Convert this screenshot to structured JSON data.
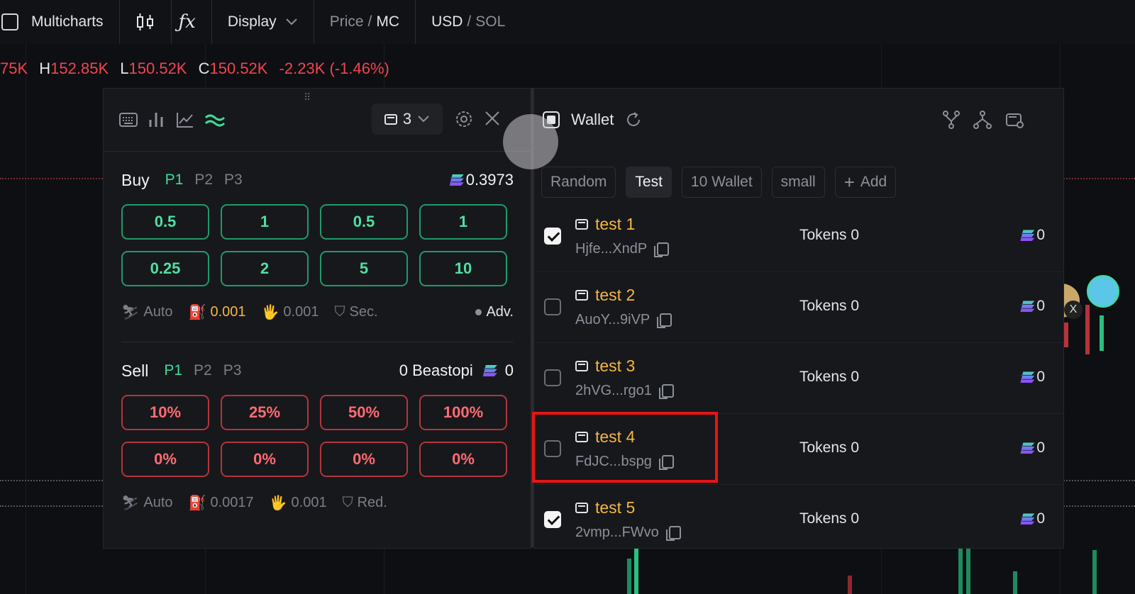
{
  "topbar": {
    "multicharts": "Multicharts",
    "fx": "ƒx",
    "display": "Display",
    "price": "Price",
    "mc": "MC",
    "usd": "USD",
    "sol": "SOL",
    "slash": "/"
  },
  "ohlc": {
    "open": "75K",
    "h_label": "H",
    "high": "152.85K",
    "l_label": "L",
    "low": "150.52K",
    "c_label": "C",
    "close": "150.52K",
    "change": "-2.23K (-1.46%)"
  },
  "left_panel": {
    "wallet_count": "3",
    "buy": {
      "title": "Buy",
      "presets": [
        "P1",
        "P2",
        "P3"
      ],
      "balance": "0.3973",
      "amounts": [
        "0.5",
        "1",
        "0.5",
        "1",
        "0.25",
        "2",
        "5",
        "10"
      ],
      "opts": {
        "auto": "Auto",
        "gas": "0.001",
        "tip": "0.001",
        "sec": "Sec.",
        "adv": "Adv."
      }
    },
    "sell": {
      "title": "Sell",
      "presets": [
        "P1",
        "P2",
        "P3"
      ],
      "token_balance": "0 Beastopi",
      "sol_balance": "0",
      "amounts": [
        "10%",
        "25%",
        "50%",
        "100%",
        "0%",
        "0%",
        "0%",
        "0%"
      ],
      "opts": {
        "auto": "Auto",
        "gas": "0.0017",
        "tip": "0.001",
        "red": "Red."
      }
    }
  },
  "right_panel": {
    "title": "Wallet",
    "groups": [
      "Random",
      "Test",
      "10 Wallet",
      "small"
    ],
    "active_group": "Test",
    "add": "Add",
    "wallets": [
      {
        "name": "test 1",
        "addr": "Hjfe...XndP",
        "tokens": "Tokens 0",
        "bal": "0",
        "checked": true
      },
      {
        "name": "test 2",
        "addr": "AuoY...9iVP",
        "tokens": "Tokens 0",
        "bal": "0",
        "checked": false
      },
      {
        "name": "test 3",
        "addr": "2hVG...rgo1",
        "tokens": "Tokens 0",
        "bal": "0",
        "checked": false
      },
      {
        "name": "test 4",
        "addr": "FdJC...bspg",
        "tokens": "Tokens 0",
        "bal": "0",
        "checked": false
      },
      {
        "name": "test 5",
        "addr": "2vmp...FWvo",
        "tokens": "Tokens 0",
        "bal": "0",
        "checked": true
      }
    ]
  },
  "colors": {
    "buy": "#3ddc97",
    "sell": "#ff6b72",
    "wallet_name": "#f5b642",
    "highlight": "#e81414"
  }
}
